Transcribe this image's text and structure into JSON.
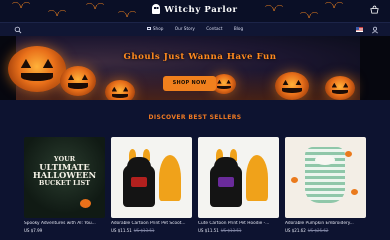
{
  "header": {
    "brand": "Witchy Parlor",
    "cart_icon": "cart-icon",
    "ghost_icon": "ghost-logo-icon"
  },
  "nav": {
    "items": [
      {
        "label": "Shop",
        "icon": "shop-icon"
      },
      {
        "label": "Our Story",
        "icon": ""
      },
      {
        "label": "Contact",
        "icon": ""
      },
      {
        "label": "Blog",
        "icon": ""
      }
    ],
    "search_icon": "search-icon",
    "flag_icon": "us-flag-icon",
    "account_icon": "user-icon"
  },
  "hero": {
    "title": "Ghouls Just Wanna Have Fun",
    "button": "SHOP NOW"
  },
  "best_sellers": {
    "title": "DISCOVER BEST SELLERS",
    "products": [
      {
        "name": "Spooky Adventures with AI: You...",
        "price": "US $7.99",
        "old_price": "",
        "image_text": [
          "YOUR",
          "ULTIMATE",
          "HALLOWEEN",
          "BUCKET",
          "LIST"
        ]
      },
      {
        "name": "Adorable Cartoon Print Pet Scoot...",
        "price": "US $11.51",
        "old_price": "US $13.51"
      },
      {
        "name": "Cute Cartoon Print Pet Hoodie -...",
        "price": "US $11.51",
        "old_price": "US $13.51"
      },
      {
        "name": "Adorable Pumpkin Embroidery...",
        "price": "US $21.62",
        "old_price": "US $25.62"
      }
    ]
  },
  "colors": {
    "background": "#0d1330",
    "accent": "#f0801d",
    "section_title": "#f07a22"
  }
}
